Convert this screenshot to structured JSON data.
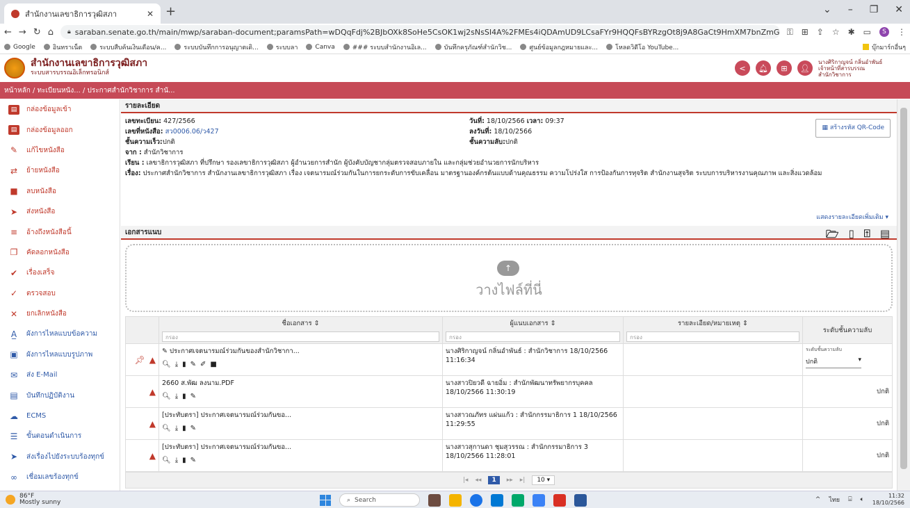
{
  "browser": {
    "tab_title": "สำนักงานเลขาธิการวุฒิสภา",
    "url": "saraban.senate.go.th/main/mwp/saraban-document;paramsPath=wDQqFdj%2BJbOXk8SoHe5CsOK1wj2sNsSI4A%2FMEs4iQDAmUD9LCsaFYr9HQQFsBYRzgOt8j9A8GaCt9HmXM7bnZmGS2uL%2F1PVWpx0GFoWass0%3D",
    "bookmarks": [
      "Google",
      "อินทราเน็ต",
      "ระบบสืบค้นเงินเดือน/ค...",
      "ระบบบันทึกการอนุญาตเดิ...",
      "ระบบลา",
      "Canva",
      "### ระบบสำนักงานอิเล...",
      "บันทึกครุภัณฑ์สำนักวิช...",
      "ศูนย์ข้อมูลกฎหมายและ...",
      "โหลดวิดีโอ YouTube..."
    ],
    "bookmarks_right": "บุ๊กมาร์กอื่นๆ"
  },
  "app": {
    "title": "สำนักงานเลขาธิการวุฒิสภา",
    "subtitle": "ระบบสารบรรณอิเล็กทรอนิกส์",
    "user_name": "นางศิริกาญจน์ กลิ่นอำพันธ์",
    "user_role": "เจ้าหน้าที่สารบรรณ",
    "user_dept": "สำนักวิชาการ"
  },
  "breadcrumb": "หน้าหลัก / ทะเบียนหนัง... / ประกาศสำนักวิชาการ สำนั...",
  "sidebar": [
    {
      "label": "กล่องข้อมูลเข้า",
      "icon": "inbox-icon"
    },
    {
      "label": "กล่องข้อมูลออก",
      "icon": "outbox-icon"
    },
    {
      "label": "แก้ไขหนังสือ",
      "icon": "pencil-icon"
    },
    {
      "label": "ย้ายหนังสือ",
      "icon": "move-icon"
    },
    {
      "label": "ลบหนังสือ",
      "icon": "trash-icon"
    },
    {
      "label": "ส่งหนังสือ",
      "icon": "send-icon"
    },
    {
      "label": "อ้างถึงหนังสือนี้",
      "icon": "reference-icon"
    },
    {
      "label": "คัดลอกหนังสือ",
      "icon": "copy-icon"
    },
    {
      "label": "เรื่องเสร็จ",
      "icon": "done-icon"
    },
    {
      "label": "ตรวจสอบ",
      "icon": "check-icon"
    },
    {
      "label": "ยกเลิกหนังสือ",
      "icon": "cancel-icon"
    },
    {
      "label": "ผังการไหลแบบข้อความ",
      "icon": "text-flow-icon"
    },
    {
      "label": "ผังการไหลแบบรูปภาพ",
      "icon": "image-flow-icon"
    },
    {
      "label": "ส่ง E-Mail",
      "icon": "mail-icon"
    },
    {
      "label": "บันทึกปฏิบัติงาน",
      "icon": "log-icon"
    },
    {
      "label": "ECMS",
      "icon": "cloud-icon"
    },
    {
      "label": "ขั้นตอนดำเนินการ",
      "icon": "steps-icon"
    },
    {
      "label": "ส่งเรื่องไปยังระบบร้องทุกข์",
      "icon": "forward-icon"
    },
    {
      "label": "เชื่อมเลขร้องทุกข์",
      "icon": "link-icon"
    }
  ],
  "detail": {
    "section_title": "รายละเอียด",
    "reg_no_label": "เลขทะเบียน:",
    "reg_no": "427/2566",
    "doc_no_label": "เลขที่หนังสือ:",
    "doc_no": "สว0006.06/ว427",
    "speed_label": "ชั้นความเร็ว:",
    "speed": "ปกติ",
    "from_label": "จาก :",
    "from": "สำนักวิชาการ",
    "to_label": "เรียน :",
    "to": "เลขาธิการวุฒิสภา ที่ปรึกษา รองเลขาธิการวุฒิสภา ผู้อำนวยการสำนัก ผู้บังคับบัญชากลุ่มตรวจสอบภายใน และกลุ่มช่วยอำนวยการนักบริหาร",
    "subject_label": "เรื่อง:",
    "subject": "ประกาศสำนักวิชาการ สำนักงานเลขาธิการวุฒิสภา เรื่อง เจตนารมณ์ร่วมกันในการยกระดับการขับเคลื่อน มาตรฐานองค์กรต้นแบบด้านคุณธรรม ความโปร่งใส การป้องกันการทุจริต สำนักงานสุจริต ระบบการบริหารงานคุณภาพ และสิ่งแวดล้อม",
    "date_label": "วันที่:",
    "date": "18/10/2566",
    "time_label": "เวลา:",
    "time": "09:37",
    "sign_date_label": "ลงวันที่:",
    "sign_date": "18/10/2566",
    "secret_label": "ชั้นความลับ:",
    "secret": "ปกติ",
    "qr_label": "สร้างรหัส QR-Code",
    "more_label": "แสดงรายละเอียดเพิ่มเติม ▾"
  },
  "attachments": {
    "section_title": "เอกสารแนบ",
    "drop_text": "วางไฟล์ที่นี่",
    "columns": [
      "ชื่อเอกสาร ⇕",
      "ผู้แนบเอกสาร ⇕",
      "รายละเอียด/หมายเหตุ ⇕",
      "ระดับชั้นความลับ"
    ],
    "filter_placeholder": "กรอง",
    "level_select_label": "ระดับชั้นความลับ",
    "rows": [
      {
        "name": "ประกาศเจตนารมณ์ร่วมกันของสำนักวิชากา...",
        "by": "นางศิริกาญจน์ กลิ่นอำพันธ์ : สำนักวิชาการ 18/10/2566 11:16:34",
        "note": "",
        "level": "ปกติ",
        "pinned": true
      },
      {
        "name": "2660 ส.พัฒ ลงนาม.PDF",
        "by": "นางสาวปิยวดี ฉายอิ่ม : สำนักพัฒนาทรัพยากรบุคคล 18/10/2566 11:30:19",
        "note": "",
        "level": "ปกติ",
        "pinned": false
      },
      {
        "name": "[ประทับตรา] ประกาศเจตนารมณ์ร่วมกันขอ...",
        "by": "นางสาวณภัทร แผ่นแก้ว : สำนักกรรมาธิการ 1 18/10/2566 11:29:55",
        "note": "",
        "level": "ปกติ",
        "pinned": false
      },
      {
        "name": "[ประทับตรา] ประกาศเจตนารมณ์ร่วมกันขอ...",
        "by": "นางสาวสุกานดา ชุมสุวรรณ : สำนักกรรมาธิการ 3 18/10/2566 11:28:01",
        "note": "",
        "level": "ปกติ",
        "pinned": false
      }
    ],
    "pager_current": "1",
    "page_size": "10"
  },
  "taskbar": {
    "temp": "86°F",
    "weather": "Mostly sunny",
    "search": "Search",
    "lang": "ไทย",
    "time": "11:32",
    "date": "18/10/2566"
  }
}
